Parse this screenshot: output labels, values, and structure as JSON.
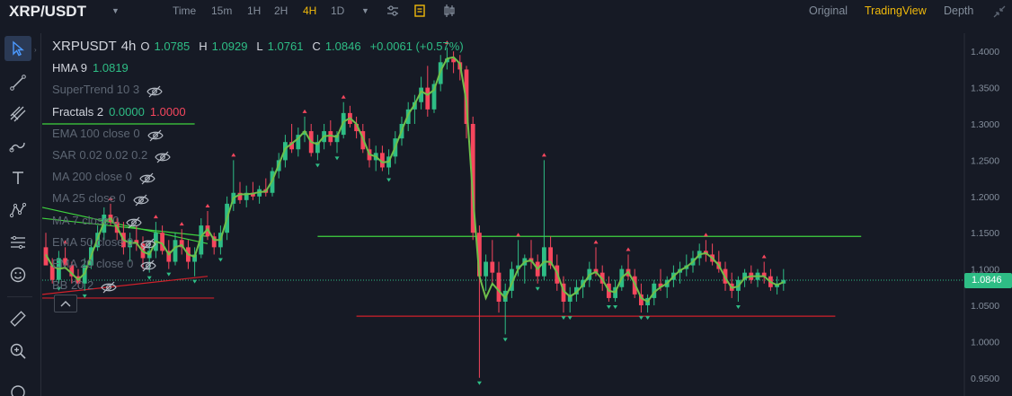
{
  "header": {
    "symbol": "XRP/USDT",
    "timeframes": [
      "Time",
      "15m",
      "1H",
      "2H",
      "4H",
      "1D"
    ],
    "active_timeframe": "4H",
    "views": [
      "Original",
      "TradingView",
      "Depth"
    ],
    "active_view": "TradingView",
    "icons": [
      "caret-down-icon",
      "more-timeframes-icon",
      "settings-sliders-icon",
      "indicators-icon",
      "candle-type-icon",
      "fullscreen-icon"
    ]
  },
  "toolbar": {
    "tools": [
      "cursor-icon",
      "trend-line-icon",
      "fib-retracement-icon",
      "brush-icon",
      "text-icon",
      "pattern-icon",
      "measure-icon",
      "emoji-icon",
      "ruler-icon",
      "zoom-in-icon",
      "magnet-icon"
    ]
  },
  "legend": {
    "symbol": "XRPUSDT",
    "interval": "4h",
    "open_label": "O",
    "open": "1.0785",
    "high_label": "H",
    "high": "1.0929",
    "low_label": "L",
    "low": "1.0761",
    "close_label": "C",
    "close": "1.0846",
    "change": "+0.0061 (+0.57%)",
    "indicators": [
      {
        "name": "HMA 9",
        "values": [
          "1.0819"
        ],
        "hidden": false
      },
      {
        "name": "SuperTrend 10 3",
        "values": [],
        "hidden": true
      },
      {
        "name": "Fractals 2",
        "values": [
          "0.0000",
          "1.0000"
        ],
        "hidden": false
      },
      {
        "name": "EMA 100 close 0",
        "values": [],
        "hidden": true
      },
      {
        "name": "SAR 0.02 0.02 0.2",
        "values": [],
        "hidden": true
      },
      {
        "name": "MA 200 close 0",
        "values": [],
        "hidden": true
      },
      {
        "name": "MA 25 close 0",
        "values": [],
        "hidden": true
      },
      {
        "name": "MA 7 close 0",
        "values": [],
        "hidden": true
      },
      {
        "name": "EMA 50 close 0",
        "values": [],
        "hidden": true
      },
      {
        "name": "EMA 20 close 0",
        "values": [],
        "hidden": true
      },
      {
        "name": "BB 20 2",
        "values": [],
        "hidden": true
      }
    ]
  },
  "colors": {
    "up": "#2ebd85",
    "down": "#f6465d",
    "hma": "#6fbf4a",
    "accent": "#f0b90b",
    "support": "#d0202a",
    "resistance": "#3fd43f"
  },
  "chart_data": {
    "type": "candlestick",
    "symbol": "XRPUSDT",
    "interval": "4h",
    "y_ticks": [
      "1.4000",
      "1.3500",
      "1.3000",
      "1.2500",
      "1.2000",
      "1.1500",
      "1.1000",
      "1.0500",
      "1.0000",
      "0.9500"
    ],
    "ylim": [
      0.925,
      1.425
    ],
    "last_price": "1.0846",
    "candles": [
      [
        1.13,
        1.15,
        1.12,
        1.105
      ],
      [
        1.105,
        1.115,
        1.08,
        1.085
      ],
      [
        1.085,
        1.125,
        1.08,
        1.115
      ],
      [
        1.115,
        1.13,
        1.1,
        1.105
      ],
      [
        1.105,
        1.11,
        1.08,
        1.09
      ],
      [
        1.09,
        1.1,
        1.075,
        1.08
      ],
      [
        1.08,
        1.115,
        1.07,
        1.105
      ],
      [
        1.105,
        1.14,
        1.1,
        1.13
      ],
      [
        1.13,
        1.16,
        1.125,
        1.15
      ],
      [
        1.15,
        1.185,
        1.14,
        1.175
      ],
      [
        1.175,
        1.19,
        1.16,
        1.165
      ],
      [
        1.165,
        1.17,
        1.14,
        1.15
      ],
      [
        1.15,
        1.165,
        1.12,
        1.13
      ],
      [
        1.13,
        1.15,
        1.11,
        1.14
      ],
      [
        1.14,
        1.16,
        1.125,
        1.135
      ],
      [
        1.135,
        1.145,
        1.1,
        1.115
      ],
      [
        1.115,
        1.135,
        1.095,
        1.125
      ],
      [
        1.125,
        1.165,
        1.115,
        1.15
      ],
      [
        1.15,
        1.16,
        1.12,
        1.125
      ],
      [
        1.125,
        1.14,
        1.1,
        1.11
      ],
      [
        1.11,
        1.15,
        1.105,
        1.14
      ],
      [
        1.14,
        1.155,
        1.12,
        1.13
      ],
      [
        1.13,
        1.14,
        1.1,
        1.11
      ],
      [
        1.11,
        1.13,
        1.09,
        1.12
      ],
      [
        1.12,
        1.17,
        1.115,
        1.16
      ],
      [
        1.16,
        1.18,
        1.14,
        1.145
      ],
      [
        1.145,
        1.15,
        1.12,
        1.13
      ],
      [
        1.13,
        1.16,
        1.12,
        1.15
      ],
      [
        1.15,
        1.2,
        1.14,
        1.19
      ],
      [
        1.19,
        1.25,
        1.18,
        1.205
      ],
      [
        1.205,
        1.22,
        1.19,
        1.195
      ],
      [
        1.195,
        1.215,
        1.185,
        1.205
      ],
      [
        1.205,
        1.22,
        1.195,
        1.2
      ],
      [
        1.2,
        1.215,
        1.19,
        1.21
      ],
      [
        1.21,
        1.225,
        1.2,
        1.205
      ],
      [
        1.205,
        1.24,
        1.2,
        1.235
      ],
      [
        1.235,
        1.26,
        1.225,
        1.25
      ],
      [
        1.25,
        1.285,
        1.24,
        1.275
      ],
      [
        1.275,
        1.3,
        1.26,
        1.265
      ],
      [
        1.265,
        1.295,
        1.255,
        1.285
      ],
      [
        1.285,
        1.31,
        1.275,
        1.29
      ],
      [
        1.29,
        1.3,
        1.255,
        1.26
      ],
      [
        1.26,
        1.285,
        1.25,
        1.275
      ],
      [
        1.275,
        1.3,
        1.265,
        1.29
      ],
      [
        1.29,
        1.305,
        1.27,
        1.275
      ],
      [
        1.275,
        1.29,
        1.26,
        1.285
      ],
      [
        1.285,
        1.33,
        1.28,
        1.315
      ],
      [
        1.315,
        1.325,
        1.295,
        1.3
      ],
      [
        1.3,
        1.31,
        1.28,
        1.29
      ],
      [
        1.29,
        1.3,
        1.26,
        1.265
      ],
      [
        1.265,
        1.28,
        1.24,
        1.25
      ],
      [
        1.25,
        1.27,
        1.235,
        1.26
      ],
      [
        1.26,
        1.27,
        1.235,
        1.24
      ],
      [
        1.24,
        1.265,
        1.23,
        1.255
      ],
      [
        1.255,
        1.29,
        1.245,
        1.28
      ],
      [
        1.28,
        1.31,
        1.27,
        1.3
      ],
      [
        1.3,
        1.33,
        1.29,
        1.32
      ],
      [
        1.32,
        1.34,
        1.3,
        1.33
      ],
      [
        1.33,
        1.365,
        1.32,
        1.35
      ],
      [
        1.35,
        1.38,
        1.31,
        1.32
      ],
      [
        1.32,
        1.36,
        1.315,
        1.355
      ],
      [
        1.355,
        1.395,
        1.345,
        1.385
      ],
      [
        1.385,
        1.405,
        1.375,
        1.39
      ],
      [
        1.39,
        1.4,
        1.37,
        1.385
      ],
      [
        1.385,
        1.395,
        1.36,
        1.375
      ],
      [
        1.375,
        1.38,
        1.28,
        1.3
      ],
      [
        1.3,
        1.31,
        1.14,
        1.15
      ],
      [
        1.15,
        1.16,
        0.95,
        1.09
      ],
      [
        1.09,
        1.12,
        1.07,
        1.11
      ],
      [
        1.11,
        1.14,
        1.08,
        1.095
      ],
      [
        1.095,
        1.11,
        1.04,
        1.055
      ],
      [
        1.055,
        1.08,
        1.01,
        1.07
      ],
      [
        1.07,
        1.11,
        1.06,
        1.1
      ],
      [
        1.1,
        1.14,
        1.09,
        1.105
      ],
      [
        1.105,
        1.12,
        1.08,
        1.115
      ],
      [
        1.115,
        1.14,
        1.1,
        1.11
      ],
      [
        1.11,
        1.12,
        1.08,
        1.09
      ],
      [
        1.09,
        1.25,
        1.085,
        1.13
      ],
      [
        1.13,
        1.145,
        1.1,
        1.105
      ],
      [
        1.105,
        1.12,
        1.07,
        1.08
      ],
      [
        1.08,
        1.09,
        1.04,
        1.055
      ],
      [
        1.055,
        1.075,
        1.04,
        1.065
      ],
      [
        1.065,
        1.085,
        1.055,
        1.075
      ],
      [
        1.075,
        1.09,
        1.06,
        1.085
      ],
      [
        1.085,
        1.11,
        1.075,
        1.1
      ],
      [
        1.1,
        1.13,
        1.09,
        1.095
      ],
      [
        1.095,
        1.105,
        1.07,
        1.08
      ],
      [
        1.08,
        1.09,
        1.055,
        1.06
      ],
      [
        1.06,
        1.085,
        1.055,
        1.075
      ],
      [
        1.075,
        1.105,
        1.07,
        1.1
      ],
      [
        1.1,
        1.12,
        1.085,
        1.09
      ],
      [
        1.09,
        1.1,
        1.06,
        1.065
      ],
      [
        1.065,
        1.08,
        1.04,
        1.05
      ],
      [
        1.05,
        1.065,
        1.04,
        1.06
      ],
      [
        1.06,
        1.085,
        1.05,
        1.08
      ],
      [
        1.08,
        1.1,
        1.07,
        1.075
      ],
      [
        1.075,
        1.09,
        1.06,
        1.085
      ],
      [
        1.085,
        1.105,
        1.075,
        1.095
      ],
      [
        1.095,
        1.11,
        1.08,
        1.1
      ],
      [
        1.1,
        1.12,
        1.09,
        1.105
      ],
      [
        1.105,
        1.125,
        1.095,
        1.115
      ],
      [
        1.115,
        1.135,
        1.105,
        1.125
      ],
      [
        1.125,
        1.14,
        1.11,
        1.12
      ],
      [
        1.12,
        1.135,
        1.105,
        1.11
      ],
      [
        1.11,
        1.125,
        1.095,
        1.1
      ],
      [
        1.1,
        1.11,
        1.07,
        1.08
      ],
      [
        1.08,
        1.095,
        1.06,
        1.07
      ],
      [
        1.07,
        1.09,
        1.055,
        1.085
      ],
      [
        1.085,
        1.1,
        1.075,
        1.095
      ],
      [
        1.095,
        1.105,
        1.08,
        1.085
      ],
      [
        1.085,
        1.1,
        1.075,
        1.095
      ],
      [
        1.095,
        1.11,
        1.08,
        1.09
      ],
      [
        1.09,
        1.1,
        1.07,
        1.075
      ],
      [
        1.075,
        1.09,
        1.065,
        1.08
      ],
      [
        1.08,
        1.1,
        1.07,
        1.085
      ]
    ],
    "hma": [
      1.12,
      1.104,
      1.1,
      1.102,
      1.094,
      1.085,
      1.094,
      1.118,
      1.142,
      1.165,
      1.17,
      1.158,
      1.14,
      1.136,
      1.136,
      1.124,
      1.12,
      1.138,
      1.135,
      1.12,
      1.13,
      1.133,
      1.12,
      1.117,
      1.145,
      1.155,
      1.14,
      1.14,
      1.17,
      1.198,
      1.203,
      1.203,
      1.204,
      1.206,
      1.207,
      1.222,
      1.244,
      1.266,
      1.273,
      1.28,
      1.29,
      1.275,
      1.272,
      1.283,
      1.284,
      1.282,
      1.303,
      1.308,
      1.3,
      1.28,
      1.258,
      1.255,
      1.247,
      1.248,
      1.268,
      1.291,
      1.313,
      1.327,
      1.345,
      1.34,
      1.347,
      1.373,
      1.39,
      1.392,
      1.383,
      1.33,
      1.2,
      1.09,
      1.06,
      1.08,
      1.07,
      1.06,
      1.08,
      1.1,
      1.11,
      1.112,
      1.1,
      1.11,
      1.11,
      1.095,
      1.07,
      1.062,
      1.068,
      1.078,
      1.092,
      1.096,
      1.086,
      1.07,
      1.068,
      1.088,
      1.096,
      1.08,
      1.06,
      1.055,
      1.068,
      1.075,
      1.08,
      1.09,
      1.098,
      1.103,
      1.11,
      1.12,
      1.122,
      1.115,
      1.105,
      1.088,
      1.074,
      1.076,
      1.088,
      1.09,
      1.09,
      1.09,
      1.082,
      1.078,
      1.082
    ],
    "lines": [
      {
        "name": "resistance",
        "y": 1.145
      },
      {
        "name": "support",
        "y": 1.035
      },
      {
        "name": "left-support",
        "y": 1.06
      },
      {
        "name": "left-resistance",
        "y": 1.3
      }
    ]
  }
}
